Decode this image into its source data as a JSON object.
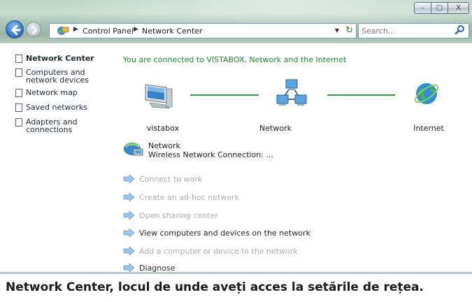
{
  "window": {
    "controls": {
      "minimize": "–",
      "maximize": "□",
      "close": "X"
    }
  },
  "address_bar": {
    "crumbs": [
      "Control Panel",
      "Network Center"
    ],
    "icons": [
      "control-panel-icon",
      "dropdown-arrow",
      "refresh-icon"
    ]
  },
  "search": {
    "placeholder": "Search..."
  },
  "sidebar": {
    "items": [
      {
        "label": "Network Center",
        "active": true
      },
      {
        "label": "Computers and network devices",
        "active": false
      },
      {
        "label": "Network map",
        "active": false
      },
      {
        "label": "Saved networks",
        "active": false
      },
      {
        "label": "Adapters and connections",
        "active": false
      }
    ]
  },
  "main": {
    "status": "You are connected to VISTABOX, Network and the Internet",
    "nodes": [
      {
        "label": "vistabox",
        "icon": "computer-icon"
      },
      {
        "label": "Network",
        "icon": "network-icon"
      },
      {
        "label": "Internet",
        "icon": "globe-icon"
      }
    ],
    "connection": {
      "name": "Network",
      "detail": "Wireless Network Connection: ..."
    },
    "tasks": [
      {
        "label": "Connect to work",
        "enabled": false
      },
      {
        "label": "Create an ad-hoc network",
        "enabled": false
      },
      {
        "label": "Open sharing center",
        "enabled": false
      },
      {
        "label": "View computers and devices on the network",
        "enabled": true
      },
      {
        "label": "Add a computer or device to the network",
        "enabled": false
      },
      {
        "label": "Diagnose",
        "enabled": true
      }
    ]
  },
  "caption": "Network Center, locul de unde aveți acces la setările de rețea.",
  "colors": {
    "status_green": "#1d8a2f",
    "link_green": "#2f9e46",
    "disabled_text": "#a9aeb2"
  }
}
